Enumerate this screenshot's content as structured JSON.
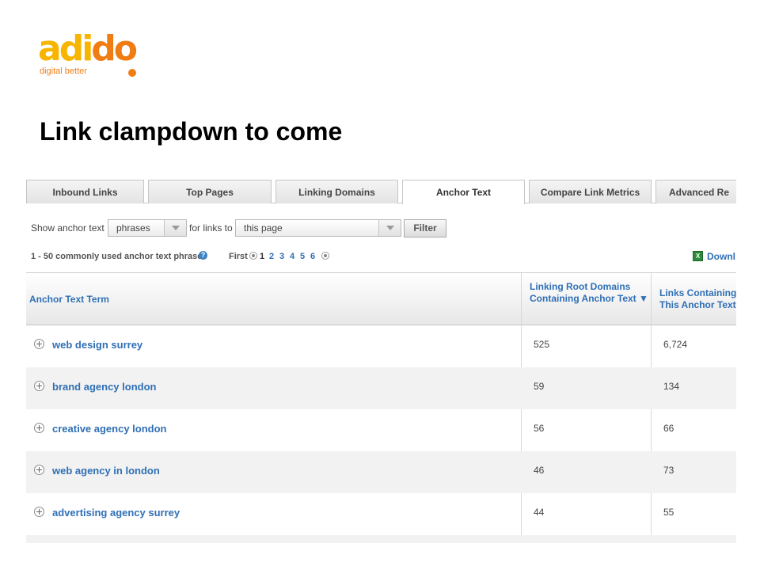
{
  "logo": {
    "word_a": "adi",
    "word_b": "do",
    "tagline": "digital better"
  },
  "slide_title": "Link clampdown to come",
  "tabs": [
    {
      "label": "Inbound Links",
      "active": false
    },
    {
      "label": "Top Pages",
      "active": false
    },
    {
      "label": "Linking Domains",
      "active": false
    },
    {
      "label": "Anchor Text",
      "active": true
    },
    {
      "label": "Compare Link Metrics",
      "active": false
    },
    {
      "label": "Advanced Re",
      "active": false
    }
  ],
  "filter": {
    "show_label": "Show anchor text",
    "type_value": "phrases",
    "for_links_label": "for links to",
    "target_value": "this page",
    "button_label": "Filter"
  },
  "info": {
    "count_text": "1 - 50 commonly used anchor text phrases",
    "help_icon": "?",
    "pager_first": "First",
    "pager_current": "1",
    "pager_pages": [
      "2",
      "3",
      "4",
      "5",
      "6"
    ],
    "download_label": "Downl"
  },
  "table": {
    "columns": {
      "term": "Anchor Text Term",
      "root_domains": "Linking Root Domains Containing Anchor Text ▼",
      "links": "Links Containing This Anchor Text"
    },
    "rows": [
      {
        "term": "web design surrey",
        "root_domains": "525",
        "links": "6,724"
      },
      {
        "term": "brand agency london",
        "root_domains": "59",
        "links": "134"
      },
      {
        "term": "creative agency london",
        "root_domains": "56",
        "links": "66"
      },
      {
        "term": "web agency in london",
        "root_domains": "46",
        "links": "73"
      },
      {
        "term": "advertising agency surrey",
        "root_domains": "44",
        "links": "55"
      }
    ]
  },
  "colors": {
    "logo_yellow": "#f7b500",
    "logo_orange": "#f07d14",
    "link_blue": "#2f6fb5",
    "row_alt": "#f2f2f2"
  }
}
